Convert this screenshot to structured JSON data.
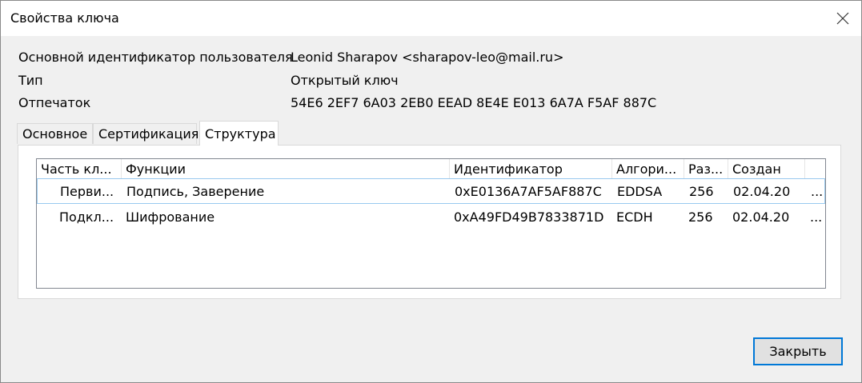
{
  "window": {
    "title": "Свойства ключа"
  },
  "properties": [
    {
      "label": "Основной идентификатор пользователя",
      "value": "Leonid Sharapov <sharapov-leo@mail.ru>"
    },
    {
      "label": "Тип",
      "value": "Открытый ключ"
    },
    {
      "label": "Отпечаток",
      "value": "54E6 2EF7 6A03 2EB0 EEAD 8E4E E013 6A7A F5AF 887C"
    }
  ],
  "tabs": [
    {
      "label": "Основное",
      "active": false
    },
    {
      "label": "Сертификация",
      "active": false
    },
    {
      "label": "Структура",
      "active": true
    }
  ],
  "table": {
    "columns": [
      "Часть кл...",
      "Функции",
      "Идентификатор",
      "Алгори...",
      "Раз...",
      "Создан",
      ""
    ],
    "rows": [
      {
        "part": "Перви...",
        "functions": "Подпись, Заверение",
        "id": "0xE0136A7AF5AF887C",
        "algo": "EDDSA",
        "size": "256",
        "created": "02.04.20",
        "more": "...",
        "selected": true
      },
      {
        "part": "Подкл...",
        "functions": "Шифрование",
        "id": "0xA49FD49B7833871D",
        "algo": "ECDH",
        "size": "256",
        "created": "02.04.20",
        "more": "...",
        "selected": false
      }
    ]
  },
  "buttons": {
    "close_label": "Закрыть"
  },
  "icons": {
    "close": "close-icon"
  }
}
